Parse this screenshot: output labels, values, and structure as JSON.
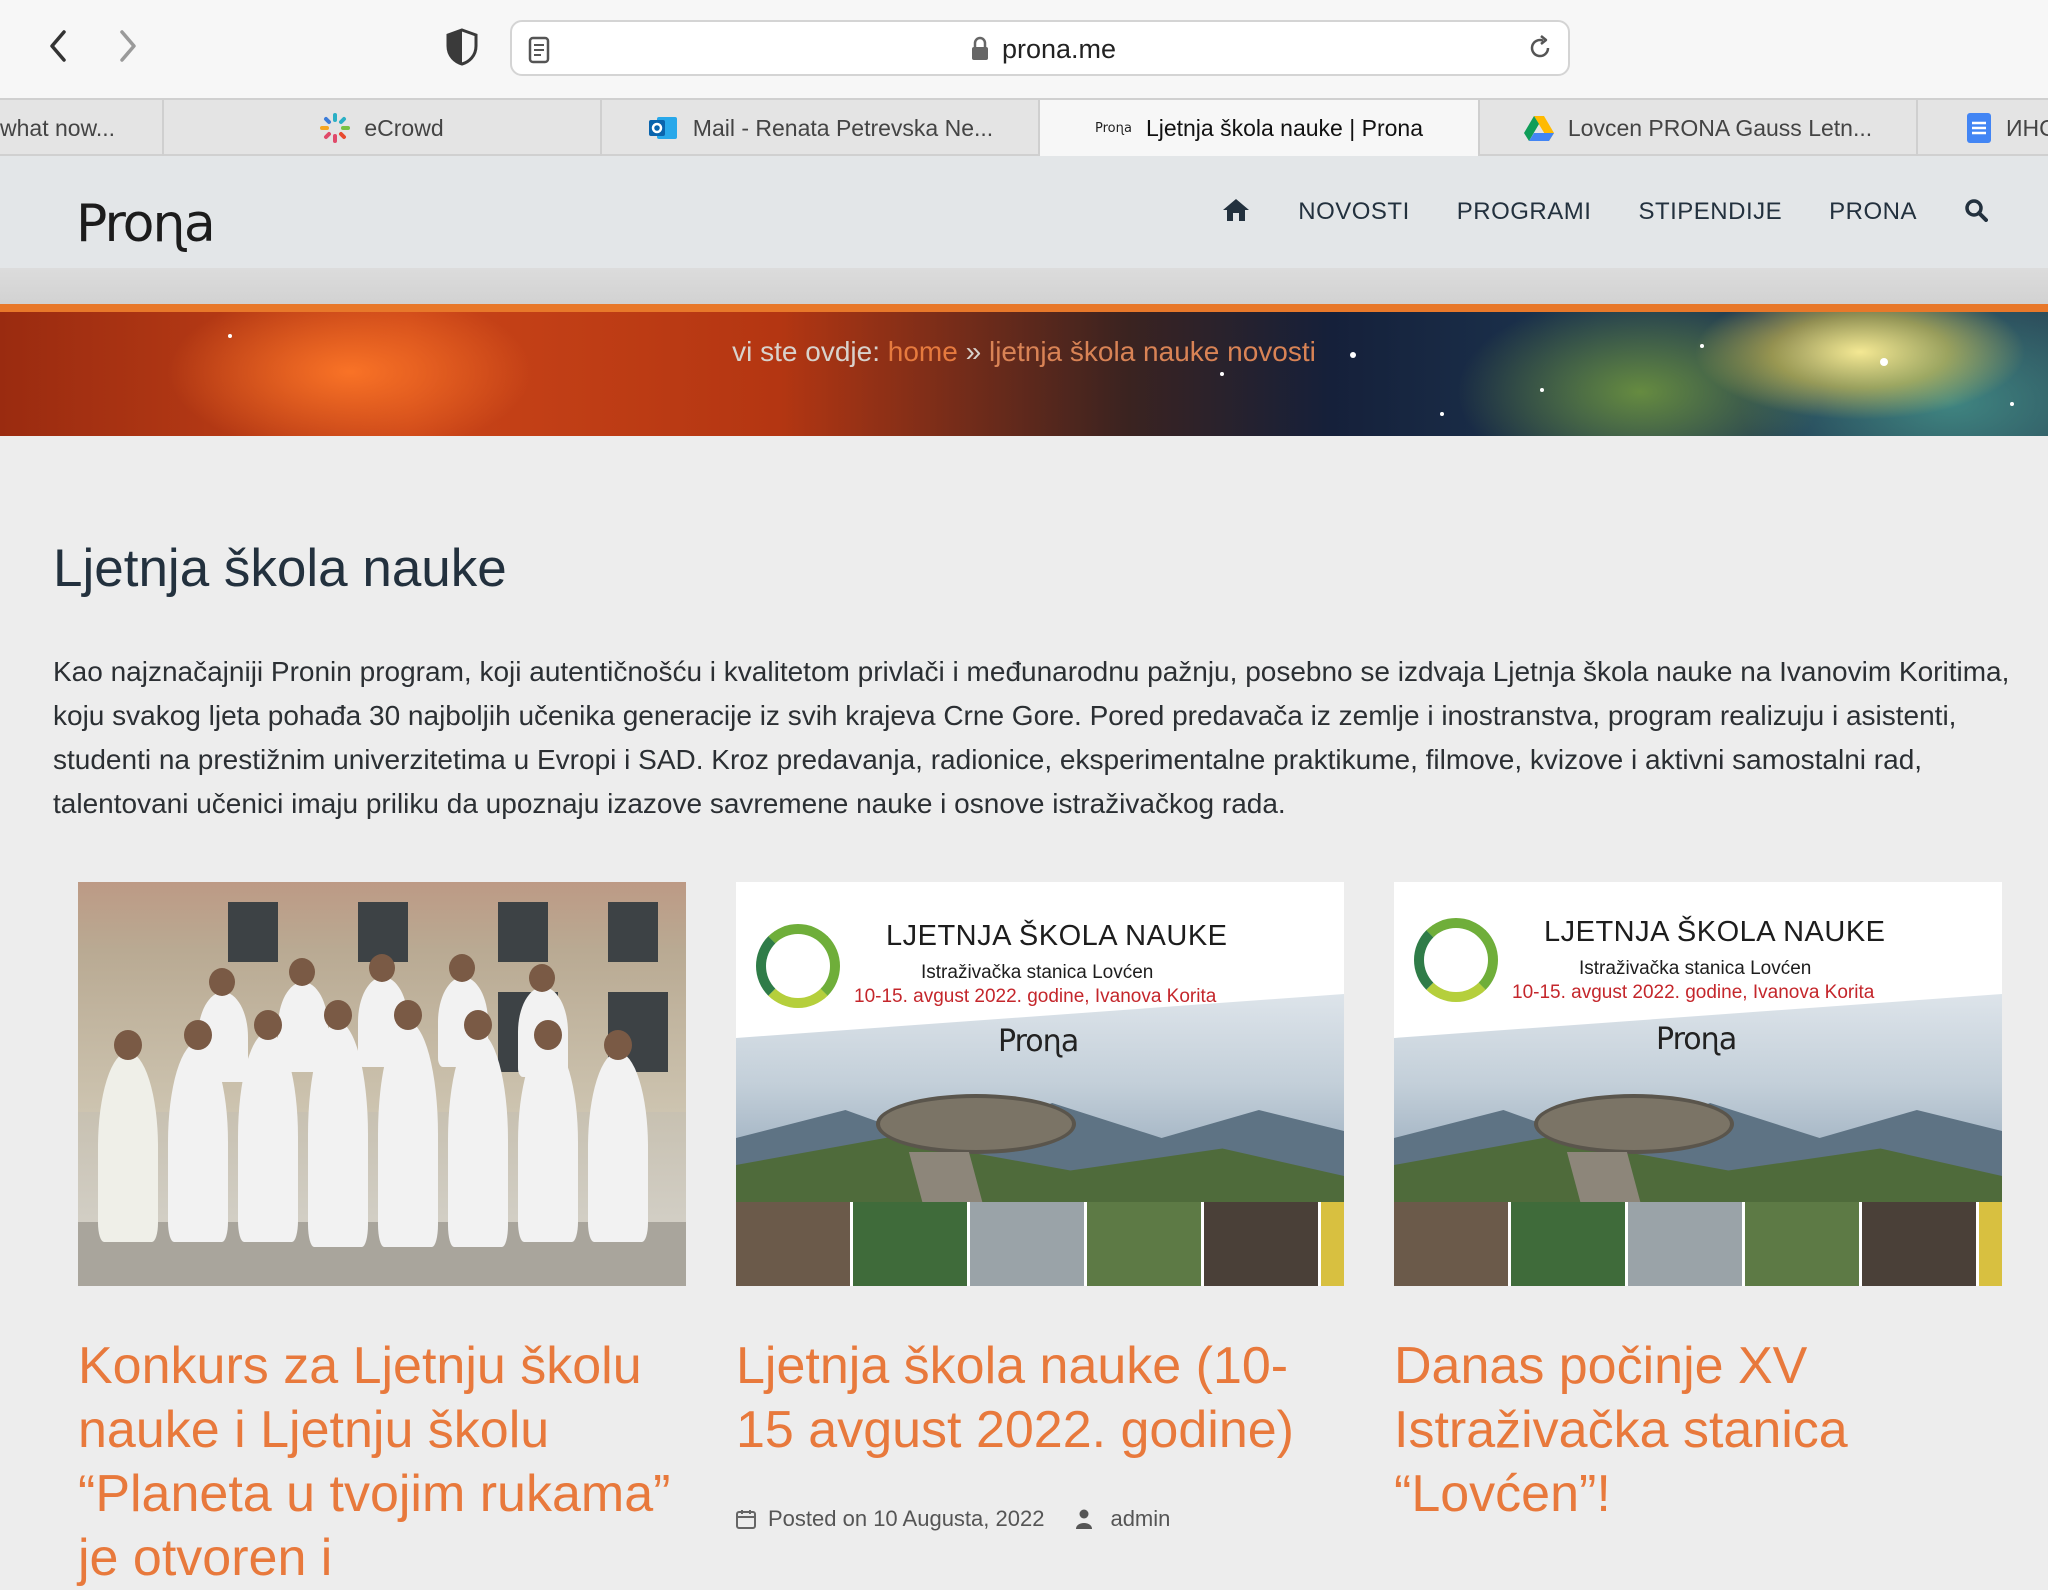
{
  "browser": {
    "url": "prona.me",
    "tabs": [
      {
        "label": "what now..."
      },
      {
        "label": "eCrowd"
      },
      {
        "label": "Mail - Renata Petrevska Ne..."
      },
      {
        "label": "Ljetnja škola nauke | Prona"
      },
      {
        "label": "Lovcen PRONA Gauss Letn..."
      },
      {
        "label": "ИНС"
      }
    ]
  },
  "site": {
    "logo": "Proɳa",
    "menu": [
      "NOVOSTI",
      "PROGRAMI",
      "STIPENDIJE",
      "PRONA"
    ],
    "breadcrumb": {
      "prefix": "vi ste ovdje:",
      "home": "home",
      "sep": "»",
      "current": "ljetnja škola nauke novosti"
    }
  },
  "page": {
    "title": "Ljetnja škola nauke",
    "intro": "Kao najznačajniji Pronin program, koji autentičnošću i kvalitetom privlači i međunarodnu pažnju, posebno se izdvaja Ljetnja škola nauke na Ivanovim Koritima, koju svakog ljeta pohađa 30 najboljih učenika generacije iz svih krajeva Crne Gore. Pored predavača iz zemlje i inostranstva, program realizuju i asistenti, studenti na prestižnim univerzitetima u Evropi i SAD. Kroz predavanja, radionice, eksperimentalne praktikume, filmove, kvizove i aktivni samostalni rad, talentovani učenici imaju priliku da upoznaju izazove savremene nauke i osnove istraživačkog rada."
  },
  "poster": {
    "title": "LJETNJA ŠKOLA NAUKE",
    "subtitle": "Istraživačka stanica Lovćen",
    "dates": "10-15. avgust 2022. godine, Ivanova Korita",
    "logo": "Proɳa"
  },
  "posts": [
    {
      "title": "Konkurs za Ljetnju školu nauke i Ljetnju školu “Planeta u tvojim rukama” je otvoren i"
    },
    {
      "title": "Ljetnja škola nauke (10-15 avgust 2022. godine)",
      "meta": {
        "posted": "Posted on 10 Augusta, 2022",
        "author": "admin"
      }
    },
    {
      "title": "Danas počinje XV Istraživačka stanica “Lovćen”!"
    }
  ]
}
